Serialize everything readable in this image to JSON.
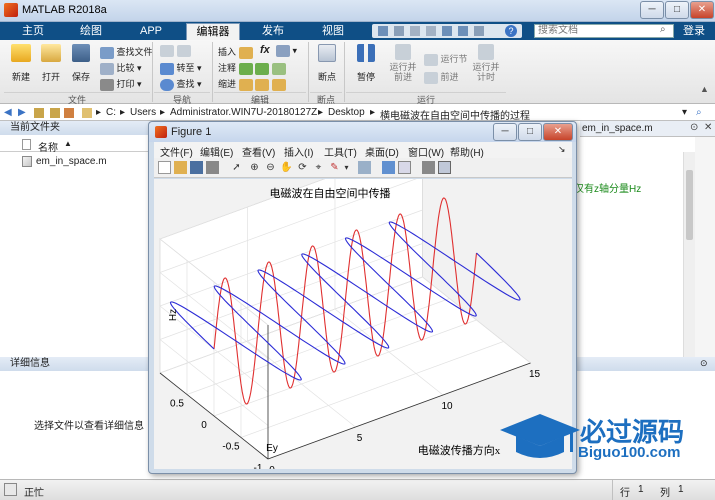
{
  "window": {
    "title": "MATLAB R2018a"
  },
  "tabs": [
    "主页",
    "绘图",
    "APP",
    "编辑器",
    "发布",
    "视图"
  ],
  "search": {
    "placeholder": "搜索文档"
  },
  "login": "登录",
  "ribbon": {
    "new": "新建",
    "open": "打开",
    "save": "保存",
    "find_files": "查找文件",
    "compare": "比较",
    "print": "打印",
    "goto": "转至",
    "find": "查找",
    "insert": "插入",
    "fx": "fx",
    "comment": "注释",
    "indent": "缩进",
    "breakpoint": "断点",
    "pause": "暂停",
    "run_advance": "运行并\n前进",
    "run_section": "运行节",
    "advance": "前进",
    "run_time": "运行并\n计时",
    "sections": [
      "文件",
      "导航",
      "编辑",
      "断点",
      "运行"
    ]
  },
  "address": {
    "path": [
      "C:",
      "Users",
      "Administrator.WIN7U-20180127Z",
      "Desktop",
      "横电磁波在自由空间中传播的过程"
    ]
  },
  "current_folder": {
    "title": "当前文件夹",
    "column": "名称",
    "files": [
      "em_in_space.m"
    ]
  },
  "details": {
    "title": "详细信息",
    "message": "选择文件以查看详细信息"
  },
  "editor": {
    "tab": "em_in_space.m",
    "snippet": "仅有z轴分量Hz"
  },
  "status": {
    "text": "正忙",
    "row_label": "行",
    "row": "1",
    "col_label": "列",
    "col": "1"
  },
  "figure": {
    "title": "Figure 1",
    "menu": [
      "文件(F)",
      "编辑(E)",
      "查看(V)",
      "插入(I)",
      "工具(T)",
      "桌面(D)",
      "窗口(W)",
      "帮助(H)"
    ]
  },
  "chart_data": {
    "type": "line",
    "title": "电磁波在自由空间中传播",
    "xlabel": "电磁波传播方向x",
    "ylabel": "Ey",
    "zlabel": "Hz",
    "xlim": [
      0,
      15
    ],
    "ylim": [
      -1,
      1
    ],
    "zlim": [
      -1,
      1
    ],
    "xticks": [
      0,
      5,
      10,
      15
    ],
    "yticks": [
      -1,
      -0.5,
      0,
      0.5
    ],
    "zticks": [
      -1,
      -0.5,
      0,
      0.5,
      1
    ],
    "grid": true,
    "series": [
      {
        "name": "Hz",
        "color": "#e03030",
        "plane": "xz",
        "wavelength": 2.5,
        "periods": 6,
        "amplitude": 1
      },
      {
        "name": "Ey",
        "color": "#2c2cd6",
        "plane": "xy",
        "wavelength": 2.5,
        "periods": 6,
        "amplitude": 1
      }
    ]
  },
  "logo": {
    "name": "必过源码",
    "site": "Biguo100.com",
    "color": "#1d6fc0"
  }
}
